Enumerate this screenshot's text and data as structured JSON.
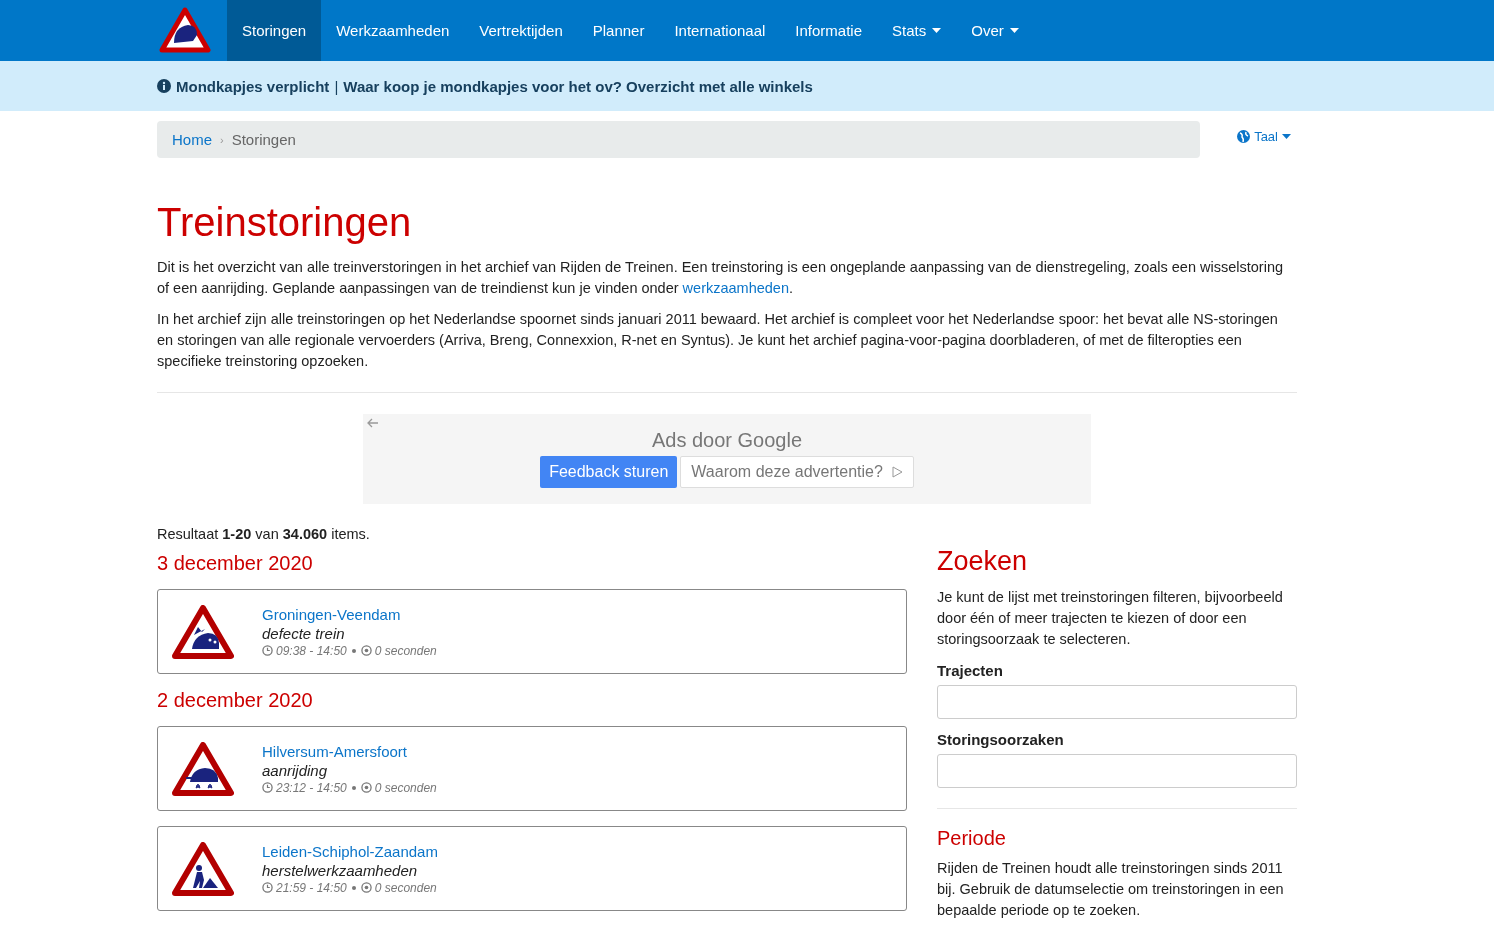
{
  "nav": {
    "items": [
      {
        "label": "Storingen",
        "selected": true,
        "dropdown": false
      },
      {
        "label": "Werkzaamheden",
        "selected": false,
        "dropdown": false
      },
      {
        "label": "Vertrektijden",
        "selected": false,
        "dropdown": false
      },
      {
        "label": "Planner",
        "selected": false,
        "dropdown": false
      },
      {
        "label": "Internationaal",
        "selected": false,
        "dropdown": false
      },
      {
        "label": "Informatie",
        "selected": false,
        "dropdown": false
      },
      {
        "label": "Stats",
        "selected": false,
        "dropdown": true
      },
      {
        "label": "Over",
        "selected": false,
        "dropdown": true
      }
    ]
  },
  "notice": {
    "title": "Mondkapjes verplicht",
    "separator": "|",
    "link": "Waar koop je mondkapjes voor het ov? Overzicht met alle winkels"
  },
  "breadcrumb": [
    {
      "label": "Home",
      "current": false
    },
    {
      "label": "Storingen",
      "current": true
    }
  ],
  "breadcrumb_separator": "›",
  "language": {
    "label": "Taal"
  },
  "title": "Treinstoringen",
  "intro": [
    "Dit is het overzicht van alle treinverstoringen in het archief van Rijden de Treinen. Een treinstoring is een ongeplande aanpassing van de dienstregeling, zoals een wisselstoring of een aanrijding. Geplande aanpassingen van de treindienst kun je vinden onder ",
    "In het archief zijn alle treinstoringen op het Nederlandse spoornet sinds januari 2011 bewaard. Het archief is compleet voor het Nederlandse spoor: het bevat alle NS-storingen en storingen van alle regionale vervoerders (Arriva, Breng, Connexxion, R-net en Syntus). Je kunt het archief pagina-voor-pagina doorbladeren, of met de filteropties een specifieke treinstoring opzoeken."
  ],
  "intro_link": "werkzaamheden",
  "intro_link_end": ".",
  "ad": {
    "title": "Ads door Google",
    "feedback_button": "Feedback sturen",
    "why_button": "Waarom deze advertentie?"
  },
  "result_summary": "Resultaat **1-20** van **34.060** items.",
  "days": [
    {
      "date": "3 december 2020",
      "incidents": [
        {
          "route": "Groningen-Veendam",
          "cause": "defecte trein",
          "time": "09:38 - 14:50",
          "duration": "0 seconden",
          "kind": "defect"
        }
      ]
    },
    {
      "date": "2 december 2020",
      "incidents": [
        {
          "route": "Hilversum-Amersfoort",
          "cause": "aanrijding",
          "time": "23:12 - 14:50",
          "duration": "0 seconden",
          "kind": "collision"
        },
        {
          "route": "Leiden-Schiphol-Zaandam",
          "cause": "herstelwerkzaamheden",
          "time": "21:59 - 14:50",
          "duration": "0 seconden",
          "kind": "works"
        }
      ]
    }
  ],
  "search": {
    "title": "Zoeken",
    "text": "Je kunt de lijst met treinstoringen filteren, bijvoorbeeld door één of meer trajecten te kiezen of door een storingsoorzaak te selecteren.",
    "fields": [
      {
        "label": "Trajecten"
      },
      {
        "label": "Storingsoorzaken"
      }
    ]
  },
  "period": {
    "title": "Periode",
    "text": "Rijden de Treinen houdt alle treinstoringen sinds 2011 bij. Gebruik de datumselectie om treinstoringen in een bepaalde periode op te zoeken."
  }
}
